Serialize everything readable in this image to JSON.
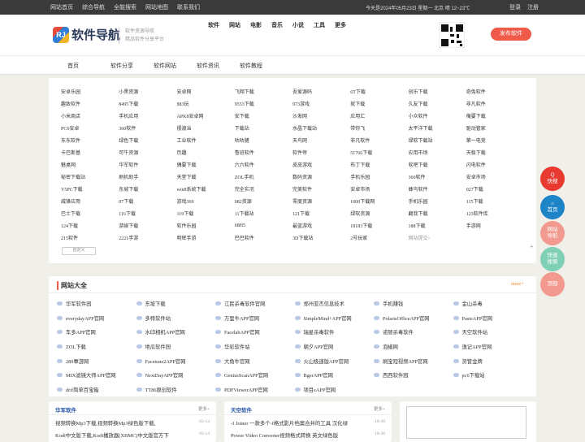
{
  "topbar": {
    "links": [
      "网站首页",
      "综合导航",
      "全能搜索",
      "网站地图",
      "联系我们"
    ],
    "date": "今天是2024年05月23日 星期一 北京 晴 12~23℃",
    "login": "登录",
    "register": "注册"
  },
  "header": {
    "logo_badge": "RJ",
    "logo_text": "软件导航",
    "slogan1": "软件资源导航",
    "slogan2": "精品软件分享平台",
    "nav": [
      "软件",
      "网站",
      "电影",
      "音乐",
      "小说",
      "工具",
      "更多"
    ],
    "publish": "发布软件"
  },
  "subnav": [
    "首页",
    "软件分享",
    "软件网站",
    "软件资讯",
    "软件教程"
  ],
  "grid": [
    [
      "安卓乐园",
      "小黑资源",
      "安卓网",
      "飞翔下载",
      "吾爱源码",
      "6T下载",
      "创乐下载",
      "奇兔软件"
    ],
    [
      "趣致软件",
      "8495下载",
      "883玩",
      "9553下载",
      "973游戏",
      "就下载",
      "久友下载",
      "非凡软件"
    ],
    [
      "小米商店",
      "手机应用",
      "APK8安卓网",
      "安下载",
      "沙发网",
      "应用汇",
      "小众软件",
      "俺要下载"
    ],
    [
      "PC6安卓",
      "360软件",
      "摆渡当",
      "下载站",
      "水晶下载站",
      "带你飞",
      "太平洋下载",
      "驱动管家"
    ],
    [
      "东东软件",
      "绿色下载",
      "工业软件",
      "咕咕猪",
      "天鸟网",
      "非凡软件",
      "绿软下载站",
      "第一电竞"
    ],
    [
      "卡巴斯基",
      "可牛资源",
      "历趣",
      "鲁班软件",
      "软件帝",
      "51766下载",
      "应用市场",
      "天极下载"
    ],
    [
      "魅桌网",
      "华军软件",
      "偶要下载",
      "六六软件",
      "皮皮游戏",
      "布丁下载",
      "软吧下载",
      "闪电软件"
    ],
    [
      "秘密下载站",
      "刷机助手",
      "天堂下载",
      "ZOL手机",
      "数码资源",
      "手机乐园",
      "360软件",
      "安卓市场"
    ],
    [
      "V5PC下载",
      "东坡下载",
      "win8系统下载",
      "完全实况",
      "完美软件",
      "安卓市场",
      "蜂鸟软件",
      "027下载"
    ],
    [
      "威锋应用",
      "07下载",
      "游戏369",
      "082资源",
      "零度资源",
      "1000下载网",
      "手机乐园",
      "115下载"
    ],
    [
      "巴士下载",
      "116下载",
      "119下载",
      "11下载站",
      "121下载",
      "绿软资源",
      "翻我下载",
      "123软件库"
    ],
    [
      "124下载",
      "游娱下载",
      "软件乐园",
      "68H5",
      "最蓝游戏",
      "18183下载",
      "188下载",
      "手游网"
    ],
    [
      "215软件",
      "2221手游",
      "明辉手游",
      "巴巴软件",
      "3D下载站",
      "2号玩家",
      "网站提交>",
      ""
    ]
  ],
  "custom_label": "自定义",
  "plus": "+",
  "sites_panel": {
    "title": "网站大全",
    "more": "more+",
    "rows": [
      [
        "华军软件园",
        "东坡下载",
        "江民杀毒软件官网",
        "郑州亚杰信息技术",
        "手机赚钱",
        "金山杀毒"
      ],
      [
        "everydayAPP官网",
        "多特软件站",
        "万里牛APP官网",
        "SimpleMind+APP官网",
        "PolarisOfficeAPP官网",
        "PasteAPP官网"
      ],
      [
        "车多APP官网",
        "水印相机APP官网",
        "FacelabAPP官网",
        "瑞星杀毒软件",
        "诺顿杀毒软件",
        "天空软件站"
      ],
      [
        "ZOL下载",
        "地瓜软件园",
        "华彩软件站",
        "朝夕APP官网",
        "泡椒网",
        "逸记APP官网"
      ],
      [
        "289軍游网",
        "Facetune2APP官网",
        "大角牛官网",
        "火山极速版APP官网",
        "刷宝短视频APP官网",
        "货管金牌"
      ],
      [
        "MIX滤镜大师APP官网",
        "NextDayAPP官网",
        "GeniusScanAPP官网",
        "BgerAPP官网",
        "西西软件园",
        "pc6下载站"
      ],
      [
        "drif简单百宝箱",
        "TT86原创软件",
        "PDFViewerAPP官网",
        "项目eAPP官网",
        "",
        ""
      ]
    ]
  },
  "cards": [
    {
      "title": "华军软件",
      "more": "更多+",
      "items": [
        {
          "text": "视频转换Mp3下载,视频转换Mp3绿色版下载,",
          "date": "03-14"
        },
        {
          "text": "Kodi中文版下载,Kodi播放器(XBMC)中文版官方下",
          "date": "03-14"
        }
      ]
    },
    {
      "title": "天空软件",
      "more": "更多+",
      "items": [
        {
          "text": "-I Joiner 一款多个-I格式影片档案合并的工具 汉化绿",
          "date": "10-30"
        },
        {
          "text": "Power Video Converter视频格式转换 英文绿色版",
          "date": "10-30"
        }
      ]
    }
  ],
  "fabs": [
    {
      "line1": "Q",
      "line2": "快搜"
    },
    {
      "line1": "⌂",
      "line2": "首页"
    },
    {
      "line1": "网站",
      "line2": "导航"
    },
    {
      "line1": "快速",
      "line2": "搜索"
    },
    {
      "line1": "顶部",
      "line2": ""
    }
  ],
  "colors": {
    "accent": "#f05a4a",
    "link": "#2a5aa8"
  }
}
